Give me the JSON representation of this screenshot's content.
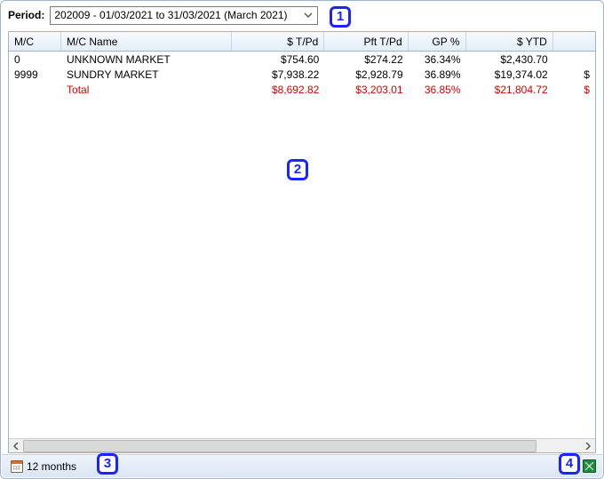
{
  "period": {
    "label": "Period:",
    "selected": "202009 - 01/03/2021 to 31/03/2021 (March 2021)"
  },
  "callouts": {
    "c1": "1",
    "c2": "2",
    "c3": "3",
    "c4": "4"
  },
  "grid": {
    "columns": {
      "mc": "M/C",
      "mcname": "M/C Name",
      "stpd": "$ T/Pd",
      "pfttpd": "Pft T/Pd",
      "gp": "GP %",
      "sytd": "$ YTD"
    },
    "rows": [
      {
        "mc": "0",
        "mcname": "UNKNOWN MARKET",
        "stpd": "$754.60",
        "pfttpd": "$274.22",
        "gp": "36.34%",
        "sytd": "$2,430.70",
        "tail": ""
      },
      {
        "mc": "9999",
        "mcname": "SUNDRY MARKET",
        "stpd": "$7,938.22",
        "pfttpd": "$2,928.79",
        "gp": "36.89%",
        "sytd": "$19,374.02",
        "tail": "$"
      }
    ],
    "total": {
      "mc": "",
      "mcname": "Total",
      "stpd": "$8,692.82",
      "pfttpd": "$3,203.01",
      "gp": "36.85%",
      "sytd": "$21,804.72",
      "tail": "$"
    }
  },
  "footer": {
    "twelve_months": "12 months"
  }
}
